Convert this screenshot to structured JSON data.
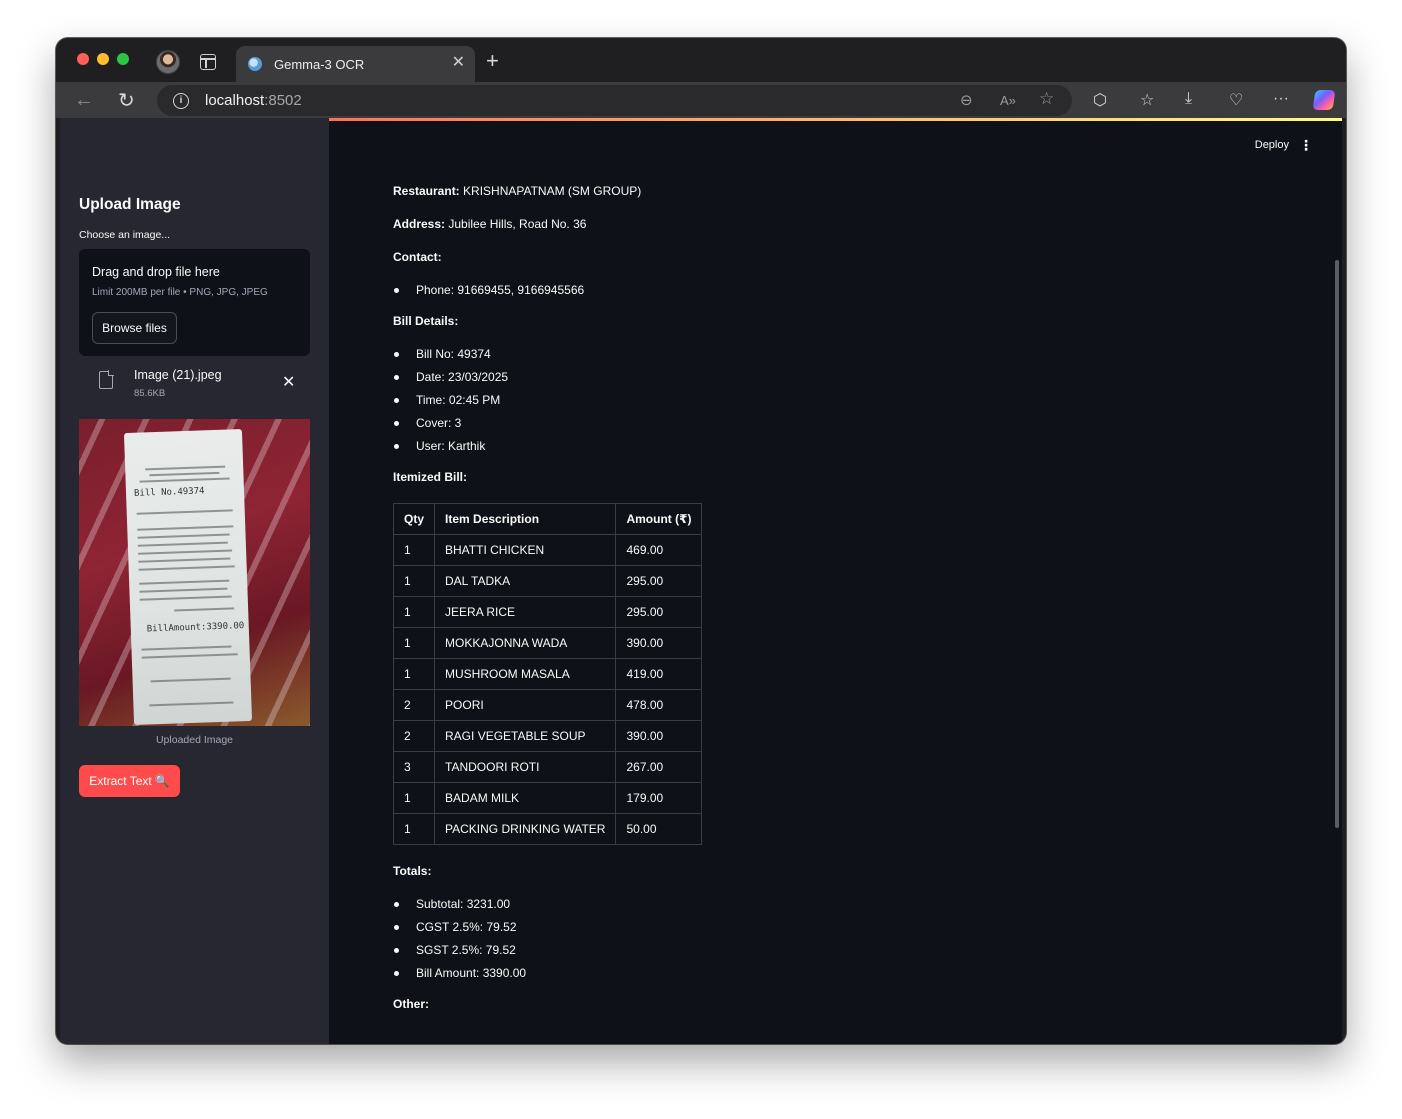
{
  "browser": {
    "tab_title": "Gemma-3 OCR",
    "tab_close": "✕",
    "new_tab": "+",
    "url_host": "localhost",
    "url_port": ":8502"
  },
  "header": {
    "deploy_label": "Deploy",
    "menu_glyph": "⋮"
  },
  "sidebar": {
    "title": "Upload Image",
    "uploader_label": "Choose an image...",
    "dropzone_title": "Drag and drop file here",
    "dropzone_limit": "Limit 200MB per file • PNG, JPG, JPEG",
    "browse_label": "Browse files",
    "file_name": "Image (21).jpeg",
    "file_size": "85.6KB",
    "remove_glyph": "✕",
    "image_caption": "Uploaded Image",
    "receipt_bill_no": "Bill No.49374",
    "receipt_amount": "BillAmount:3390.00",
    "extract_label": "Extract Text",
    "extract_emoji": "🔍"
  },
  "result": {
    "restaurant_label": "Restaurant:",
    "restaurant": "KRISHNAPATNAM (SM GROUP)",
    "address_label": "Address:",
    "address": "Jubilee Hills, Road No. 36",
    "contact_label": "Contact:",
    "contact_items": [
      "Phone: 91669455, 9166945566"
    ],
    "bill_details_label": "Bill Details:",
    "bill_details": [
      "Bill No: 49374",
      "Date: 23/03/2025",
      "Time: 02:45 PM",
      "Cover: 3",
      "User: Karthik"
    ],
    "itemized_label": "Itemized Bill:",
    "table_headers": [
      "Qty",
      "Item Description",
      "Amount (₹)"
    ],
    "table_rows": [
      [
        "1",
        "BHATTI CHICKEN",
        "469.00"
      ],
      [
        "1",
        "DAL TADKA",
        "295.00"
      ],
      [
        "1",
        "JEERA RICE",
        "295.00"
      ],
      [
        "1",
        "MOKKAJONNA WADA",
        "390.00"
      ],
      [
        "1",
        "MUSHROOM MASALA",
        "419.00"
      ],
      [
        "2",
        "POORI",
        "478.00"
      ],
      [
        "2",
        "RAGI VEGETABLE SOUP",
        "390.00"
      ],
      [
        "3",
        "TANDOORI ROTI",
        "267.00"
      ],
      [
        "1",
        "BADAM MILK",
        "179.00"
      ],
      [
        "1",
        "PACKING DRINKING WATER",
        "50.00"
      ]
    ],
    "totals_label": "Totals:",
    "totals": [
      "Subtotal: 3231.00",
      "CGST 2.5%: 79.52",
      "SGST 2.5%: 79.52",
      "Bill Amount: 3390.00"
    ],
    "other_label": "Other:"
  },
  "colors": {
    "page_bg": "#0e1117",
    "sidebar_bg": "#262730",
    "primary_button": "#ff4b4b",
    "text": "#fafafa"
  },
  "icons": [
    "search-favicon-icon",
    "back-arrow-icon",
    "reload-icon",
    "info-icon",
    "zoom-out-icon",
    "read-aloud-icon",
    "favorite-star-icon",
    "extensions-icon",
    "favorites-icon",
    "downloads-icon",
    "browser-essentials-icon",
    "more-icon",
    "copilot-icon",
    "file-icon",
    "close-icon"
  ]
}
